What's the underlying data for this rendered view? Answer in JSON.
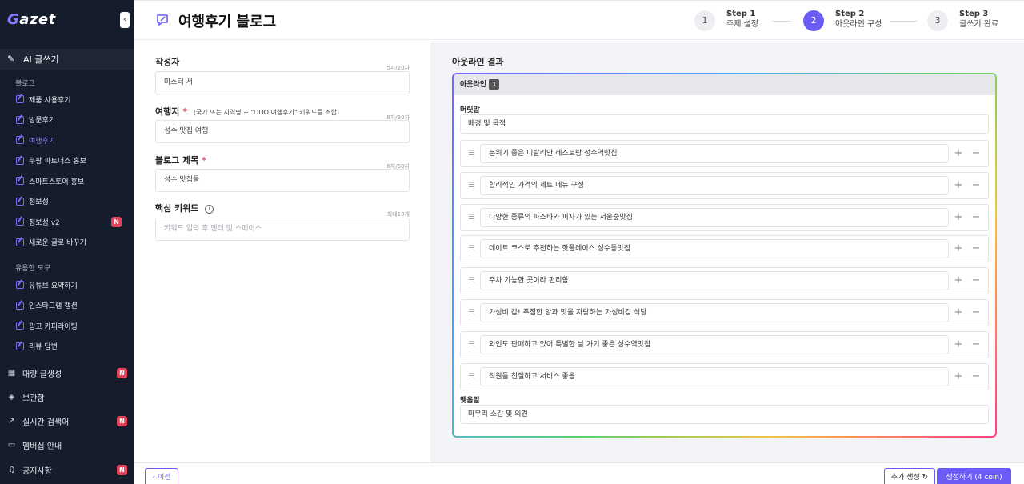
{
  "sidebar": {
    "logo": "Gazet",
    "collapse_icon": "chevron-left",
    "ai_writing": "AI 글쓰기",
    "blog_section": "블로그",
    "blog_items": [
      {
        "label": "제품 사용후기",
        "active": false,
        "new": false
      },
      {
        "label": "방문후기",
        "active": false,
        "new": false
      },
      {
        "label": "여행후기",
        "active": true,
        "new": false
      },
      {
        "label": "쿠팡 파트너스 홍보",
        "active": false,
        "new": false
      },
      {
        "label": "스마트스토어 홍보",
        "active": false,
        "new": false
      },
      {
        "label": "정보성",
        "active": false,
        "new": false
      },
      {
        "label": "정보성 v2",
        "active": false,
        "new": true
      },
      {
        "label": "새로운 글로 바꾸기",
        "active": false,
        "new": false
      }
    ],
    "tools_section": "유용한 도구",
    "tool_items": [
      {
        "label": "유튜브 요약하기"
      },
      {
        "label": "인스타그램 캡션"
      },
      {
        "label": "광고 카피라이팅"
      },
      {
        "label": "리뷰 답변"
      }
    ],
    "main_items": [
      {
        "label": "대량 글생성",
        "icon": "calendar-icon",
        "new": true
      },
      {
        "label": "보관함",
        "icon": "archive-icon",
        "new": false
      },
      {
        "label": "실시간 검색어",
        "icon": "trend-icon",
        "new": true
      },
      {
        "label": "멤버십 안내",
        "icon": "card-icon",
        "new": false
      },
      {
        "label": "공지사항",
        "icon": "bell-icon",
        "new": true
      }
    ],
    "new_badge": "N"
  },
  "header": {
    "title": "여행후기 블로그",
    "steps": [
      {
        "num": "1",
        "step": "Step 1",
        "label": "주제 설정",
        "active": false
      },
      {
        "num": "2",
        "step": "Step 2",
        "label": "아웃라인 구성",
        "active": true
      },
      {
        "num": "3",
        "step": "Step 3",
        "label": "글쓰기 완료",
        "active": false
      }
    ]
  },
  "form": {
    "author": {
      "label": "작성자",
      "count": "5자/20자",
      "value": "마스터 서"
    },
    "destination": {
      "label": "여행지",
      "required": "*",
      "hint": "(국가 또는 지역명 + \"OOO 여행후기\" 키워드를 조합)",
      "count": "8자/30자",
      "value": "성수 맛집 여행"
    },
    "blog_title": {
      "label": "블로그 제목",
      "required": "*",
      "count": "6자/50자",
      "value": "성수 맛집들"
    },
    "keywords": {
      "label": "핵심 키워드",
      "info": "i",
      "count": "최대10개",
      "placeholder": "키워드 입력 후 엔터 및 스페이스"
    }
  },
  "outline": {
    "result_title": "아웃라인 결과",
    "box_title": "아웃라인",
    "box_num": "1",
    "intro_label": "머릿말",
    "intro_value": "배경 및 목적",
    "items": [
      "분위기 좋은 이탈리안 레스토랑 성수역맛집",
      "합리적인 가격의 세트 메뉴 구성",
      "다양한 종류의 파스타와 피자가 있는 서울숲맛집",
      "데이트 코스로 추천하는 핫플레이스 성수동맛집",
      "주차 가능한 곳이라 편리함",
      "가성비 갑! 푸짐한 양과 맛을 자랑하는 가성비갑 식당",
      "와인도 판매하고 있어 특별한 날 가기 좋은 성수역맛집",
      "직원들 친절하고 서비스 좋음"
    ],
    "outro_label": "맺음말",
    "outro_value": "마무리 소감 및 의견"
  },
  "footer": {
    "prev": "‹ 이전",
    "more": "추가 생성",
    "generate": "생성하기 (4 coin)"
  },
  "colors": {
    "accent": "#6b5cf5",
    "sidebar": "#151c2c",
    "badge": "#e5435c"
  }
}
